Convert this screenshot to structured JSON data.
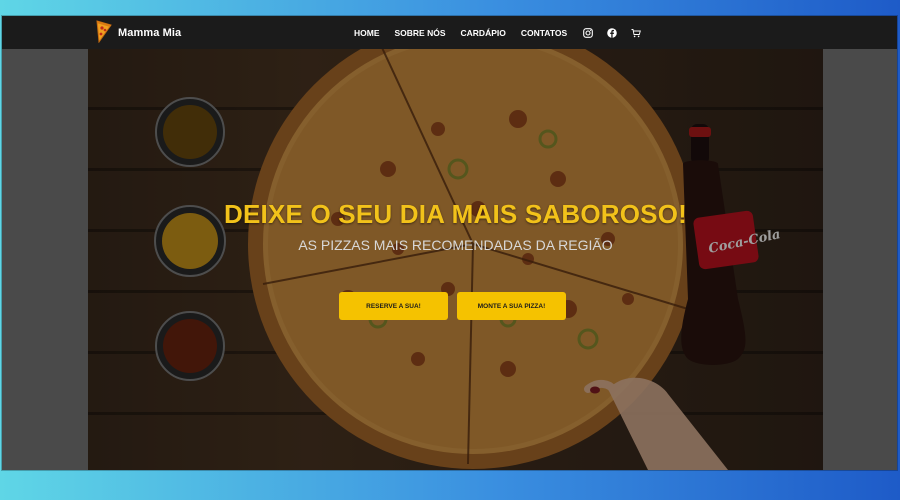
{
  "brand": {
    "name": "Mamma Mia",
    "logo_icon": "pizza-slice-icon"
  },
  "nav": {
    "links": [
      "HOME",
      "SOBRE NÓS",
      "CARDÁPIO",
      "CONTATOS"
    ],
    "icons": [
      "instagram-icon",
      "facebook-icon",
      "cart-icon"
    ]
  },
  "hero": {
    "headline": "DEIXE O SEU DIA MAIS SABOROSO!",
    "subheadline": "AS PIZZAS MAIS RECOMENDADAS DA REGIÃO",
    "buttons": [
      "RESERVE A SUA!",
      "MONTE A SUA PIZZA!"
    ],
    "bottle_label": "Coca-Cola"
  },
  "colors": {
    "accent": "#f5c200",
    "headline": "#f2c21a",
    "navbar": "#1b1b1b"
  }
}
